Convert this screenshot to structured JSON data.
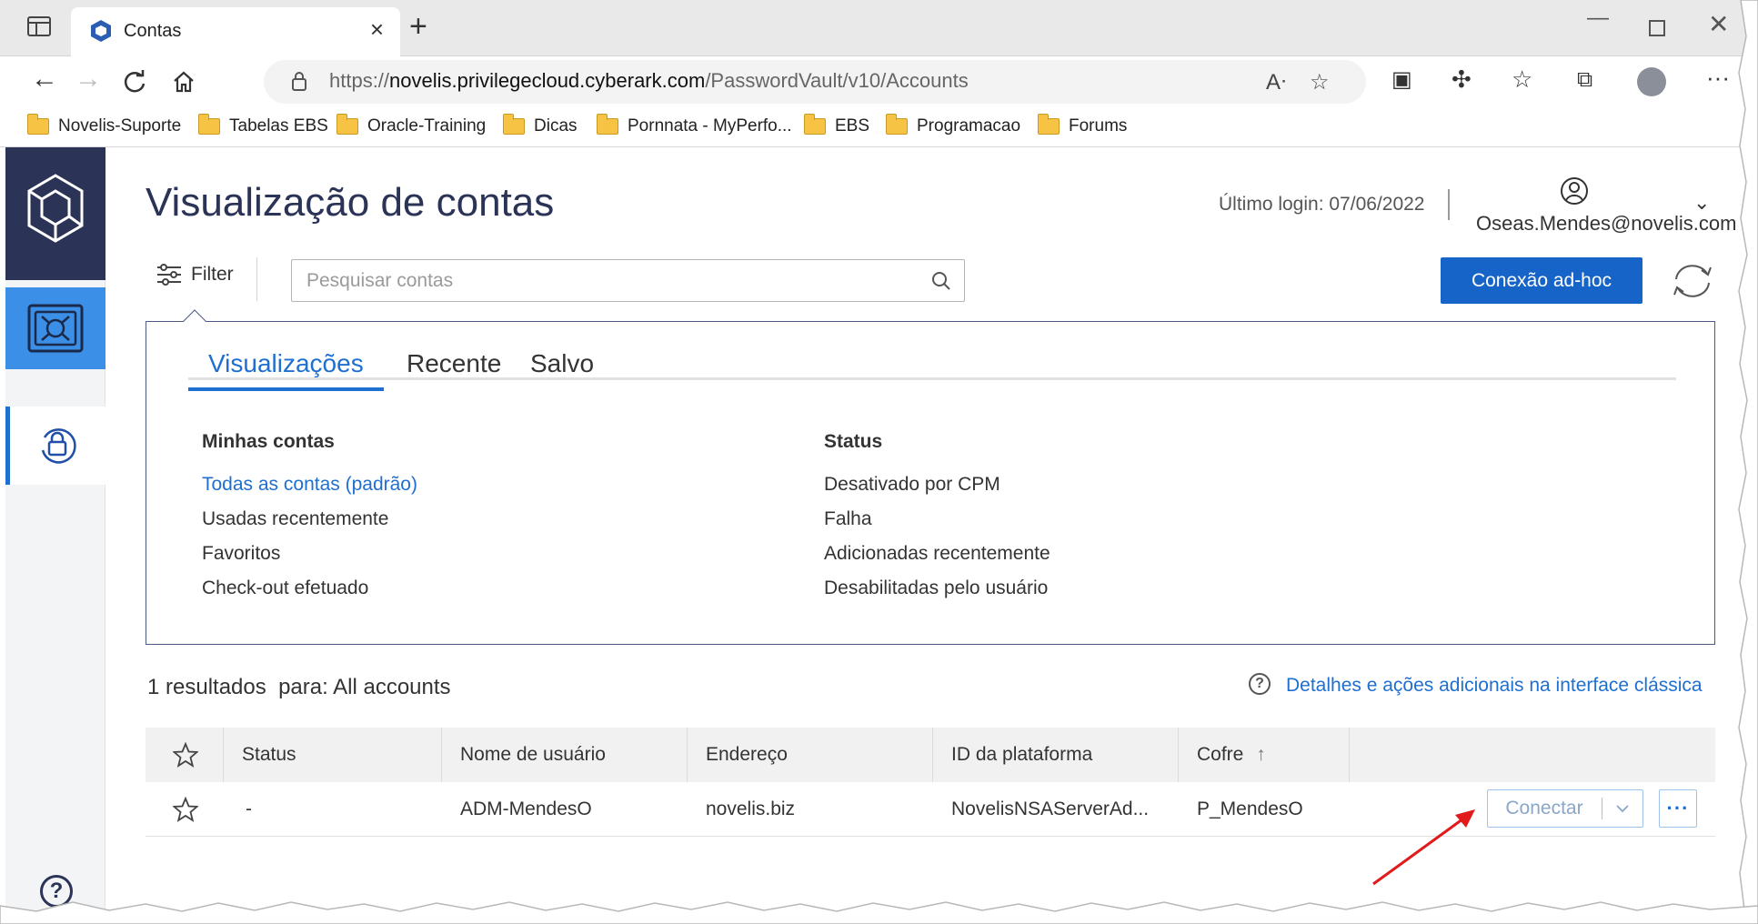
{
  "browser": {
    "tab_title": "Contas",
    "url_prefix": "https://",
    "url_host": "novelis.privilegecloud.cyberark.com",
    "url_path": "/PasswordVault/v10/Accounts",
    "bookmarks": [
      "Novelis-Suporte",
      "Tabelas EBS",
      "Oracle-Training",
      "Dicas",
      "Pornnata - MyPerfo...",
      "EBS",
      "Programacao",
      "Forums"
    ]
  },
  "header": {
    "title": "Visualização de contas",
    "last_login": "Último login: 07/06/2022",
    "user": "Oseas.Mendes@novelis.com"
  },
  "toolbar": {
    "filter_label": "Filter",
    "search_placeholder": "Pesquisar contas",
    "adhoc_label": "Conexão ad-hoc"
  },
  "views_panel": {
    "tabs": [
      "Visualizações",
      "Recente",
      "Salvo"
    ],
    "left_heading": "Minhas contas",
    "left_items": [
      "Todas as contas (padrão)",
      "Usadas recentemente",
      "Favoritos",
      "Check-out efetuado"
    ],
    "right_heading": "Status",
    "right_items": [
      "Desativado por CPM",
      "Falha",
      "Adicionadas recentemente",
      "Desabilitadas pelo usuário"
    ]
  },
  "results": {
    "summary": "1 resultados  para: All accounts",
    "classic_link": "Detalhes e ações adicionais na interface clássica"
  },
  "table": {
    "columns": [
      "Status",
      "Nome de usuário",
      "Endereço",
      "ID da plataforma",
      "Cofre"
    ],
    "sort_indicator": "↑",
    "rows": [
      {
        "status": "-",
        "username": "ADM-MendesO",
        "address": "novelis.biz",
        "platform": "NovelisNSAServerAd...",
        "safe": "P_MendesO"
      }
    ],
    "connect_label": "Conectar",
    "more_label": "···"
  },
  "colors": {
    "brand_dark": "#2b3356",
    "accent_blue": "#1664c8",
    "link_blue": "#1f6fd1",
    "annotation_arrow": "#e11b1b"
  }
}
